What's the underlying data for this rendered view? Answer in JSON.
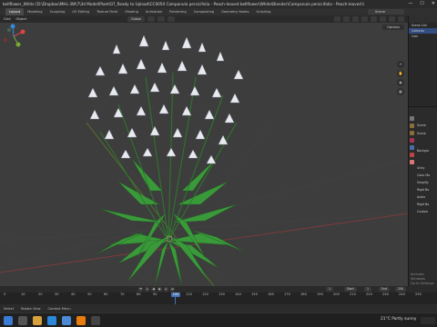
{
  "window": {
    "title": "bellflower_White [D:\\Dropbox\\MHL-3W\\7\\3d Model\\Plant\\07_Ready to Upload\\CC0050 Campanula persicifolia - Peach-leaved bellflower\\White\\Blender\\Campanula persicifolia - Peach-leaved bellflower_White.blend] - Blender",
    "controls": [
      "—",
      "☐",
      "✕"
    ]
  },
  "workspaces": [
    "Layout",
    "Modeling",
    "Sculpting",
    "UV Editing",
    "Texture Paint",
    "Shading",
    "Animation",
    "Rendering",
    "Compositing",
    "Geometry Nodes",
    "Scripting"
  ],
  "active_workspace": "Layout",
  "scene_label": "Scene",
  "header": {
    "mode": "Object Mode",
    "view": "View",
    "select": "Select",
    "add": "Add",
    "object": "Object",
    "transform": "Global",
    "left_buttons": [
      "Grid",
      "Object"
    ]
  },
  "viewport": {
    "options_label": "Options",
    "gizmo_axes": [
      "X",
      "Y",
      "Z"
    ],
    "colors": {
      "background": "#3d3d3d",
      "grid_red": "#8a3a3a",
      "grid_green": "#5d7a2a",
      "leaf": "#3a9a3a",
      "petal": "#e8eaf0"
    }
  },
  "outliner": {
    "rows": [
      "Scene Coll",
      "Collectio",
      "Cam"
    ]
  },
  "properties": {
    "labels": [
      "Scene",
      "Scene",
      "Backgro",
      "Unity",
      "Color Ma",
      "Simplify",
      "Rigid Bo",
      "Audio",
      "Rigid Bo",
      "Custom"
    ]
  },
  "activation": {
    "line1": "Activate Windows",
    "line2": "Go to Settings to activate Windows."
  },
  "timeline": {
    "ticks": [
      "0",
      "10",
      "20",
      "30",
      "40",
      "50",
      "60",
      "70",
      "80",
      "90",
      "100",
      "110",
      "120",
      "130",
      "140",
      "150",
      "160",
      "170",
      "180",
      "190",
      "200",
      "210",
      "220",
      "230",
      "240",
      "250"
    ],
    "current_frame": "1",
    "start_label": "Start",
    "start_value": "1",
    "end_label": "End",
    "end_value": "250"
  },
  "status": [
    "Select",
    "Rotate View",
    "Context Menu"
  ],
  "taskbar": {
    "weather": "21°C  Partly sunny"
  }
}
